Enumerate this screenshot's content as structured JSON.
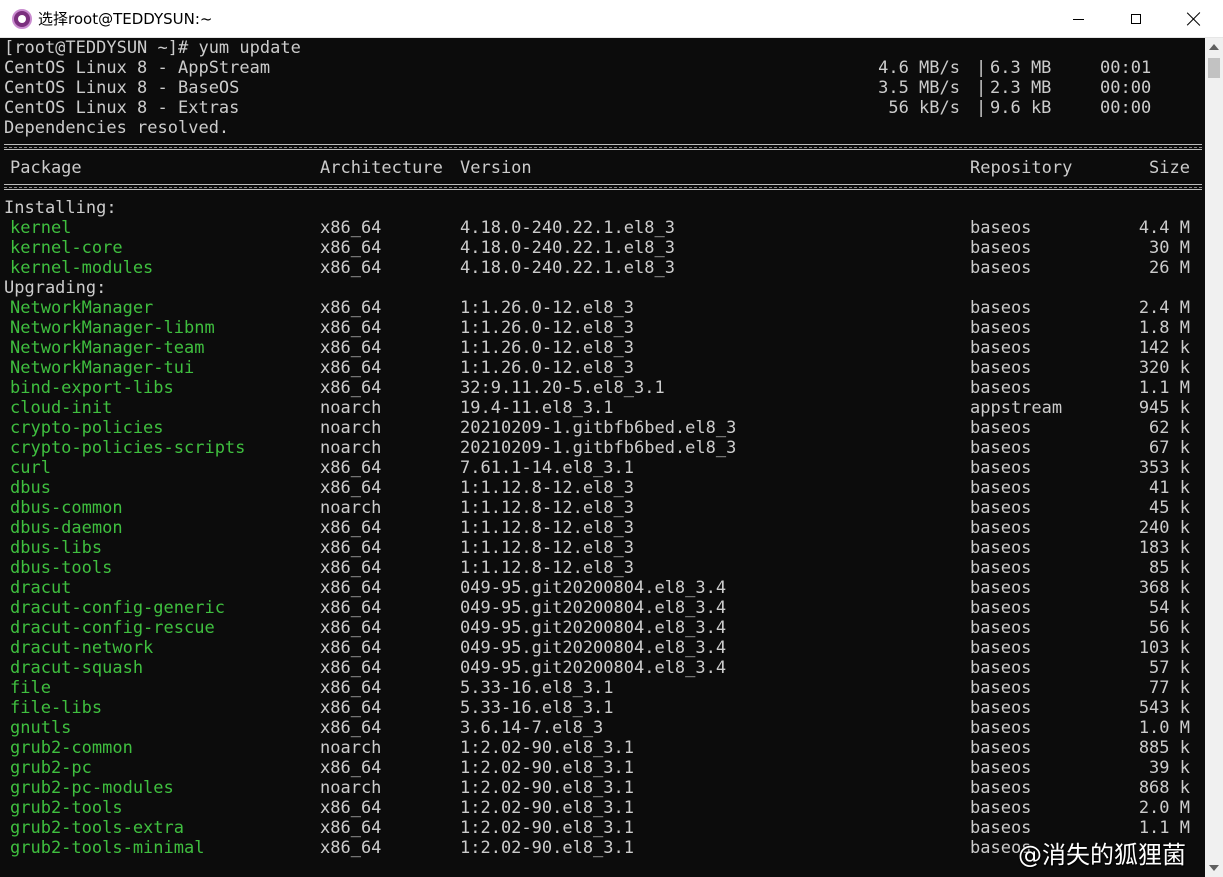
{
  "window": {
    "title": "选择root@TEDDYSUN:~"
  },
  "header_lines": [
    "[root@TEDDYSUN ~]# yum update"
  ],
  "repos": [
    {
      "name": "CentOS Linux 8 - AppStream",
      "speed": "4.6 MB/s",
      "sep": "|",
      "size": "6.3 MB",
      "time": "00:01"
    },
    {
      "name": "CentOS Linux 8 - BaseOS",
      "speed": "3.5 MB/s",
      "sep": "|",
      "size": "2.3 MB",
      "time": "00:00"
    },
    {
      "name": "CentOS Linux 8 - Extras",
      "speed": "56 kB/s",
      "sep": "|",
      "size": "9.6 kB",
      "time": "00:00"
    }
  ],
  "deps_line": "Dependencies resolved.",
  "columns": {
    "package": "Package",
    "arch": "Architecture",
    "version": "Version",
    "repo": "Repository",
    "size": "Size"
  },
  "sections": [
    {
      "label": "Installing:",
      "rows": [
        {
          "pkg": "kernel",
          "arch": "x86_64",
          "ver": "4.18.0-240.22.1.el8_3",
          "repo": "baseos",
          "size": "4.4 M"
        },
        {
          "pkg": "kernel-core",
          "arch": "x86_64",
          "ver": "4.18.0-240.22.1.el8_3",
          "repo": "baseos",
          "size": "30 M"
        },
        {
          "pkg": "kernel-modules",
          "arch": "x86_64",
          "ver": "4.18.0-240.22.1.el8_3",
          "repo": "baseos",
          "size": "26 M"
        }
      ]
    },
    {
      "label": "Upgrading:",
      "rows": [
        {
          "pkg": "NetworkManager",
          "arch": "x86_64",
          "ver": "1:1.26.0-12.el8_3",
          "repo": "baseos",
          "size": "2.4 M"
        },
        {
          "pkg": "NetworkManager-libnm",
          "arch": "x86_64",
          "ver": "1:1.26.0-12.el8_3",
          "repo": "baseos",
          "size": "1.8 M"
        },
        {
          "pkg": "NetworkManager-team",
          "arch": "x86_64",
          "ver": "1:1.26.0-12.el8_3",
          "repo": "baseos",
          "size": "142 k"
        },
        {
          "pkg": "NetworkManager-tui",
          "arch": "x86_64",
          "ver": "1:1.26.0-12.el8_3",
          "repo": "baseos",
          "size": "320 k"
        },
        {
          "pkg": "bind-export-libs",
          "arch": "x86_64",
          "ver": "32:9.11.20-5.el8_3.1",
          "repo": "baseos",
          "size": "1.1 M"
        },
        {
          "pkg": "cloud-init",
          "arch": "noarch",
          "ver": "19.4-11.el8_3.1",
          "repo": "appstream",
          "size": "945 k"
        },
        {
          "pkg": "crypto-policies",
          "arch": "noarch",
          "ver": "20210209-1.gitbfb6bed.el8_3",
          "repo": "baseos",
          "size": "62 k"
        },
        {
          "pkg": "crypto-policies-scripts",
          "arch": "noarch",
          "ver": "20210209-1.gitbfb6bed.el8_3",
          "repo": "baseos",
          "size": "67 k"
        },
        {
          "pkg": "curl",
          "arch": "x86_64",
          "ver": "7.61.1-14.el8_3.1",
          "repo": "baseos",
          "size": "353 k"
        },
        {
          "pkg": "dbus",
          "arch": "x86_64",
          "ver": "1:1.12.8-12.el8_3",
          "repo": "baseos",
          "size": "41 k"
        },
        {
          "pkg": "dbus-common",
          "arch": "noarch",
          "ver": "1:1.12.8-12.el8_3",
          "repo": "baseos",
          "size": "45 k"
        },
        {
          "pkg": "dbus-daemon",
          "arch": "x86_64",
          "ver": "1:1.12.8-12.el8_3",
          "repo": "baseos",
          "size": "240 k"
        },
        {
          "pkg": "dbus-libs",
          "arch": "x86_64",
          "ver": "1:1.12.8-12.el8_3",
          "repo": "baseos",
          "size": "183 k"
        },
        {
          "pkg": "dbus-tools",
          "arch": "x86_64",
          "ver": "1:1.12.8-12.el8_3",
          "repo": "baseos",
          "size": "85 k"
        },
        {
          "pkg": "dracut",
          "arch": "x86_64",
          "ver": "049-95.git20200804.el8_3.4",
          "repo": "baseos",
          "size": "368 k"
        },
        {
          "pkg": "dracut-config-generic",
          "arch": "x86_64",
          "ver": "049-95.git20200804.el8_3.4",
          "repo": "baseos",
          "size": "54 k"
        },
        {
          "pkg": "dracut-config-rescue",
          "arch": "x86_64",
          "ver": "049-95.git20200804.el8_3.4",
          "repo": "baseos",
          "size": "56 k"
        },
        {
          "pkg": "dracut-network",
          "arch": "x86_64",
          "ver": "049-95.git20200804.el8_3.4",
          "repo": "baseos",
          "size": "103 k"
        },
        {
          "pkg": "dracut-squash",
          "arch": "x86_64",
          "ver": "049-95.git20200804.el8_3.4",
          "repo": "baseos",
          "size": "57 k"
        },
        {
          "pkg": "file",
          "arch": "x86_64",
          "ver": "5.33-16.el8_3.1",
          "repo": "baseos",
          "size": "77 k"
        },
        {
          "pkg": "file-libs",
          "arch": "x86_64",
          "ver": "5.33-16.el8_3.1",
          "repo": "baseos",
          "size": "543 k"
        },
        {
          "pkg": "gnutls",
          "arch": "x86_64",
          "ver": "3.6.14-7.el8_3",
          "repo": "baseos",
          "size": "1.0 M"
        },
        {
          "pkg": "grub2-common",
          "arch": "noarch",
          "ver": "1:2.02-90.el8_3.1",
          "repo": "baseos",
          "size": "885 k"
        },
        {
          "pkg": "grub2-pc",
          "arch": "x86_64",
          "ver": "1:2.02-90.el8_3.1",
          "repo": "baseos",
          "size": "39 k"
        },
        {
          "pkg": "grub2-pc-modules",
          "arch": "noarch",
          "ver": "1:2.02-90.el8_3.1",
          "repo": "baseos",
          "size": "868 k"
        },
        {
          "pkg": "grub2-tools",
          "arch": "x86_64",
          "ver": "1:2.02-90.el8_3.1",
          "repo": "baseos",
          "size": "2.0 M"
        },
        {
          "pkg": "grub2-tools-extra",
          "arch": "x86_64",
          "ver": "1:2.02-90.el8_3.1",
          "repo": "baseos",
          "size": "1.1 M"
        },
        {
          "pkg": "grub2-tools-minimal",
          "arch": "x86_64",
          "ver": "1:2.02-90.el8_3.1",
          "repo": "baseos",
          "size": ""
        }
      ]
    }
  ],
  "colors": {
    "terminal_bg": "#0c0c0c",
    "text": "#cccccc",
    "package_green": "#3fbf3f"
  },
  "watermark": "@消失的狐狸菌"
}
